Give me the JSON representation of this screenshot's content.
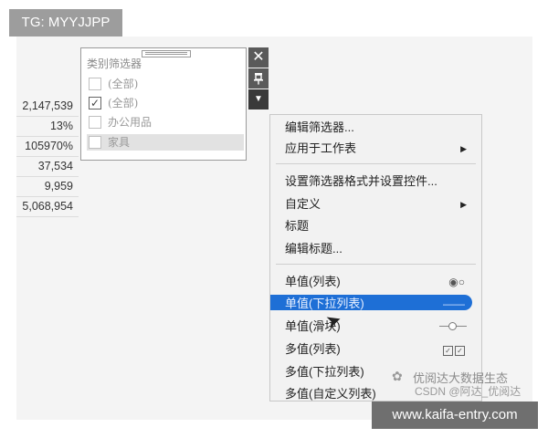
{
  "watermark_tag": "TG: MYYJJPP",
  "left_values": [
    "2,147,539",
    "13%",
    "105970%",
    "37,534",
    "9,959",
    "5,068,954"
  ],
  "filter": {
    "title": "类别筛选器",
    "options": [
      {
        "label": "(全部)",
        "checked": false
      },
      {
        "label": "(全部)",
        "checked": true
      },
      {
        "label": "办公用品",
        "checked": false
      },
      {
        "label": "家具",
        "checked": false
      }
    ]
  },
  "side_buttons": {
    "close": "✕",
    "pin": "푸",
    "dropdown": "▼"
  },
  "menu": {
    "edit_filter": "编辑筛选器...",
    "apply_to_sheets": "应用于工作表",
    "format_filter": "设置筛选器格式并设置控件...",
    "customize": "自定义",
    "title": "标题",
    "edit_title": "编辑标题...",
    "single_list": "单值(列表)",
    "single_dropdown": "单值(下拉列表)",
    "single_slider": "单值(滑块)",
    "multi_list": "多值(列表)",
    "multi_dropdown": "多值(下拉列表)",
    "multi_custom": "多值(自定义列表)"
  },
  "watermark_lines": [
    "优阅达大数据生态",
    "CSDN @阿达_优阅达"
  ],
  "footer": "www.kaifa-entry.com",
  "colors": {
    "highlight": "#1e6fd6",
    "menu_bg": "#f2f2f2"
  }
}
